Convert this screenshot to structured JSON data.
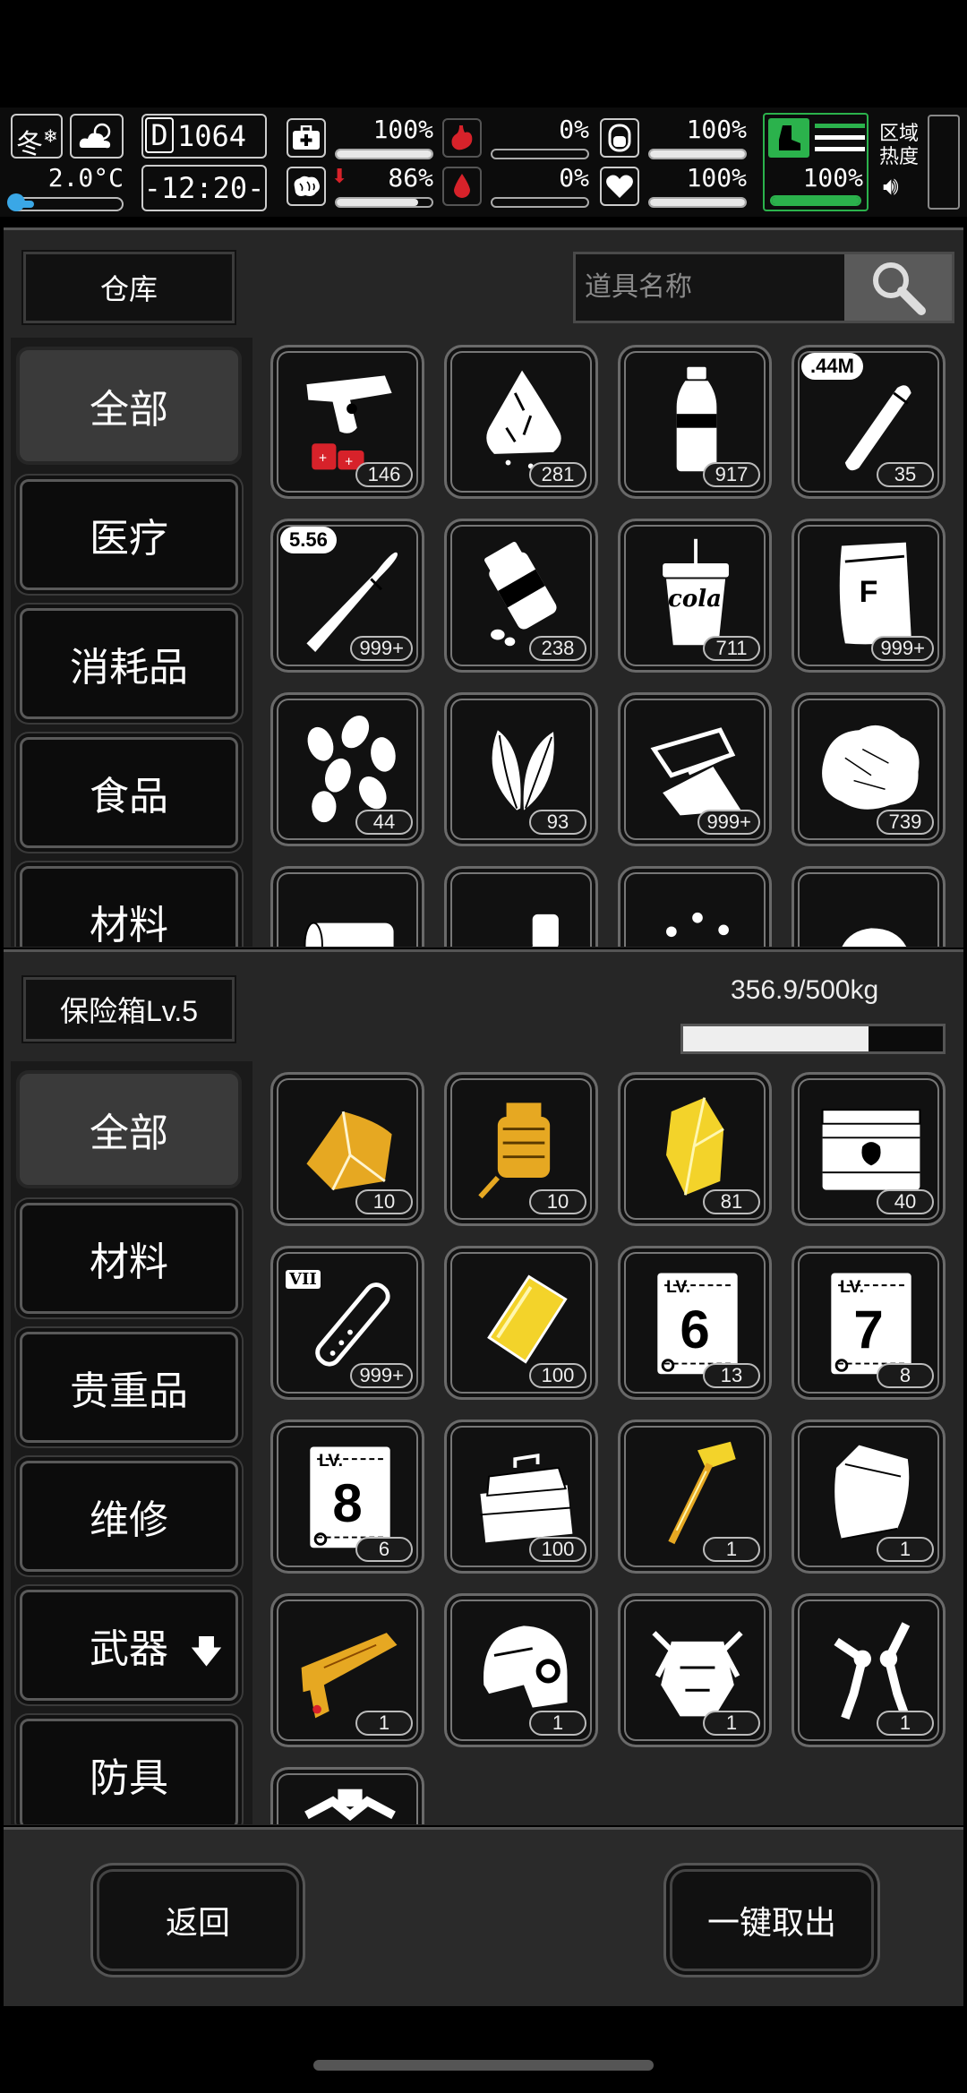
{
  "status": {
    "season": "冬",
    "temperature": "2.0°C",
    "temperature_level": 0.2,
    "day_prefix": "D",
    "day": "1064",
    "clock": "-12:20-",
    "stats": [
      {
        "icon": "medkit-icon",
        "value": "100%",
        "level": 1.0
      },
      {
        "icon": "stomach-icon",
        "value": "0%",
        "level": 0.0
      },
      {
        "icon": "water-tank-icon",
        "value": "100%",
        "level": 1.0
      },
      {
        "icon": "brain-icon",
        "value": "86%",
        "level": 0.86
      },
      {
        "icon": "blood-drop-icon",
        "value": "0%",
        "level": 0.0
      },
      {
        "icon": "heart-icon",
        "value": "100%",
        "level": 1.0
      },
      {
        "icon": "stamina-boot-icon",
        "value": "100%",
        "level": 1.0
      }
    ],
    "region_label_1": "区域",
    "region_label_2": "热度"
  },
  "warehouse": {
    "title": "仓库",
    "search_placeholder": "道具名称",
    "categories": [
      "全部",
      "医疗",
      "消耗品",
      "食品",
      "材料"
    ],
    "active_category": "全部",
    "items": [
      {
        "icon": "flare-gun-icon",
        "count": "146"
      },
      {
        "icon": "cloth-icon",
        "count": "281"
      },
      {
        "icon": "water-bottle-icon",
        "count": "917"
      },
      {
        "icon": "ammo-44m-icon",
        "count": "35",
        "tag": ".44M"
      },
      {
        "icon": "ammo-556-icon",
        "count": "999+",
        "tag": "5.56"
      },
      {
        "icon": "pill-bottle-icon",
        "count": "238"
      },
      {
        "icon": "cola-cup-icon",
        "count": "711",
        "label": "cola"
      },
      {
        "icon": "flour-bag-icon",
        "count": "999+",
        "label": "F"
      },
      {
        "icon": "seeds-icon",
        "count": "44"
      },
      {
        "icon": "leaves-icon",
        "count": "93"
      },
      {
        "icon": "paper-scraps-icon",
        "count": "999+"
      },
      {
        "icon": "cotton-icon",
        "count": "739"
      },
      {
        "icon": "paper-roll-icon",
        "count": ""
      },
      {
        "icon": "pipe-icon",
        "count": ""
      },
      {
        "icon": "beans-icon",
        "count": ""
      },
      {
        "icon": "stone-icon",
        "count": ""
      }
    ]
  },
  "safe": {
    "title": "保险箱Lv.5",
    "weight": "356.9/500kg",
    "weight_level": 0.7138,
    "categories": [
      "全部",
      "材料",
      "贵重品",
      "维修",
      "武器",
      "防具"
    ],
    "active_category": "全部",
    "items": [
      {
        "icon": "gold-ore-icon",
        "count": "10"
      },
      {
        "icon": "gold-engine-part-icon",
        "count": "10"
      },
      {
        "icon": "gold-crystal-icon",
        "count": "81"
      },
      {
        "icon": "explosive-crate-icon",
        "count": "40"
      },
      {
        "icon": "test-tube-vii-icon",
        "count": "999+",
        "label": "VII"
      },
      {
        "icon": "gold-card-icon",
        "count": "100"
      },
      {
        "icon": "blueprint-lv6-icon",
        "count": "13",
        "label": "6"
      },
      {
        "icon": "blueprint-lv7-icon",
        "count": "8",
        "label": "7"
      },
      {
        "icon": "blueprint-lv8-icon",
        "count": "6",
        "label": "8"
      },
      {
        "icon": "toolbox-icon",
        "count": "100"
      },
      {
        "icon": "gold-hammer-icon",
        "count": "1"
      },
      {
        "icon": "armor-plate-icon",
        "count": "1"
      },
      {
        "icon": "gold-shotgun-icon",
        "count": "1"
      },
      {
        "icon": "helmet-icon",
        "count": "1"
      },
      {
        "icon": "mech-torso-icon",
        "count": "1"
      },
      {
        "icon": "mech-arms-icon",
        "count": "1"
      },
      {
        "icon": "mech-legs-icon",
        "count": ""
      }
    ]
  },
  "footer": {
    "back_label": "返回",
    "take_all_label": "一键取出"
  },
  "colors": {
    "gold": "#e6a822",
    "red": "#d7222a",
    "green": "#2bb24c",
    "blue": "#3aa7e6"
  }
}
